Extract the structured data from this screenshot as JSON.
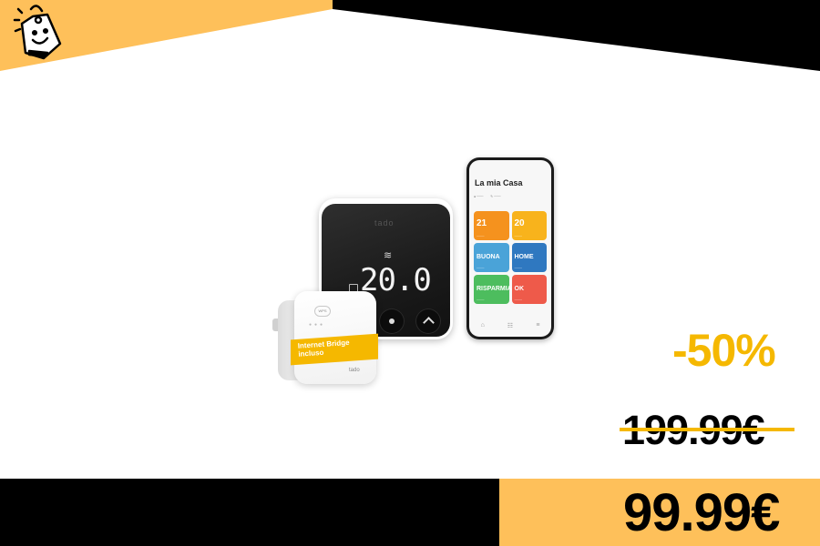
{
  "colors": {
    "accent_yellow": "#f5b800",
    "banner_orange": "#fec05a",
    "black": "#000000"
  },
  "logo": {
    "icon": "price-tag-mascot-icon"
  },
  "product": {
    "thermostat": {
      "brand": "tado",
      "temperature": "20.0"
    },
    "bridge": {
      "button_label": "WPS",
      "band_text": "Internet Bridge incluso",
      "brand": "tado"
    },
    "app": {
      "title": "La mia Casa",
      "tiles": [
        {
          "main": "21"
        },
        {
          "main": "20"
        },
        {
          "main": "BUONA"
        },
        {
          "main": "HOME"
        },
        {
          "main": "RISPARMIA"
        },
        {
          "main": "OK"
        }
      ]
    }
  },
  "pricing": {
    "discount": "-50%",
    "old_price": "199.99€",
    "new_price": "99.99€"
  }
}
